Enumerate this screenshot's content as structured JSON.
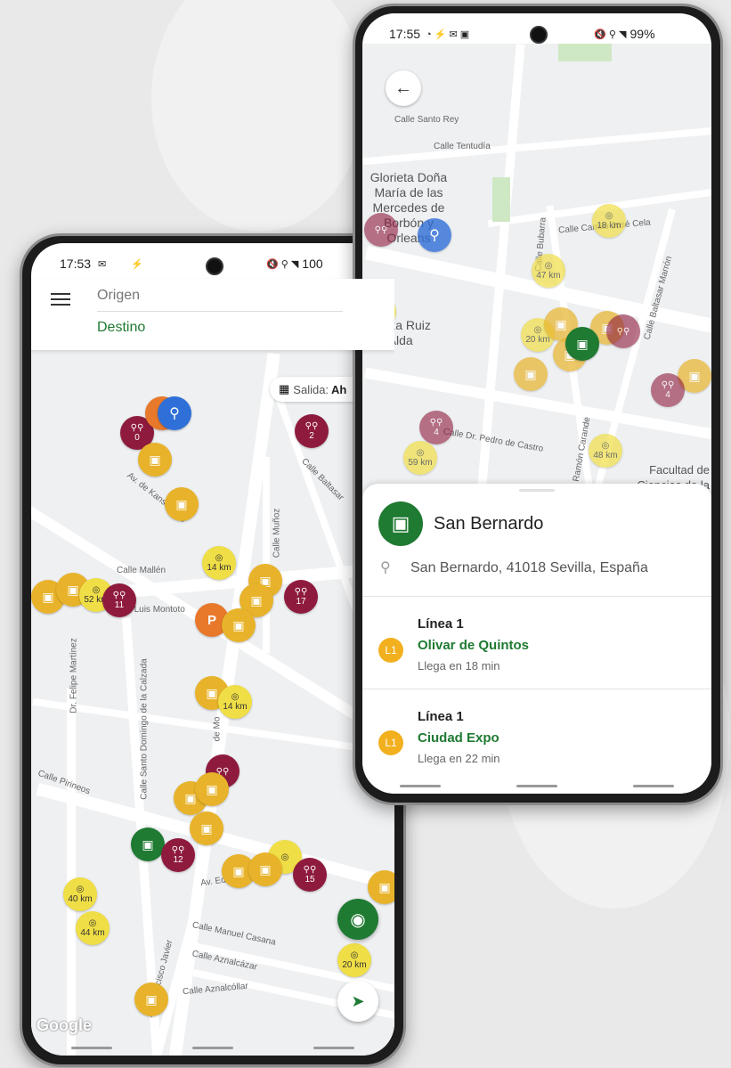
{
  "left_phone": {
    "status": {
      "time": "17:53",
      "battery": "100"
    },
    "search": {
      "origin_placeholder": "Origen",
      "destination_placeholder": "Destino"
    },
    "departure_chip": {
      "label": "Salida:",
      "value": "Ah"
    },
    "streets": [
      "Av. de Kansas City",
      "Calle Mallén",
      "Calle Luis Montoto",
      "Dr. Felipe Martínez",
      "Calle Santo Domingo de la Calzada",
      "Calle Pirineos",
      "Av. Eduardo Dato",
      "Calle Manuel Casana",
      "Calle Aznalcázar",
      "Calle Aznalcóllar",
      "Av. Francisco Javier",
      "Calle Baltasar",
      "Calle Muñoz",
      "de Mo"
    ],
    "markers": {
      "bike_counts": [
        "0",
        "2",
        "11",
        "17",
        "12",
        "15"
      ],
      "distances": [
        "14 km",
        "52 km",
        "14 km",
        "40 km",
        "44 km",
        "20 km"
      ]
    },
    "google_logo": "Google"
  },
  "right_phone": {
    "status": {
      "time": "17:55",
      "battery": "99%"
    },
    "map_labels": [
      "Glorieta Doña María de las Mercedes de Borbón y Orleans",
      "Plaza Ruiz de Alda",
      "Facultad de Ciencias de la Educación",
      "Calle Santo Rey",
      "Calle Tentudía",
      "Calle Bubarra",
      "Calle Camilo José Cela",
      "Calle Dr. Pedro de Castro",
      "Ramón Carande",
      "Calle Baltasar Marrón"
    ],
    "markers": {
      "distances": [
        "18 km",
        "47 km",
        "20 km",
        "59 km",
        "48 km"
      ],
      "bike_counts": [
        "4",
        "4"
      ]
    },
    "stop": {
      "name": "San Bernardo",
      "address": "San Bernardo, 41018 Sevilla, España"
    },
    "lines": [
      {
        "badge": "L1",
        "line": "Línea 1",
        "destination": "Olivar de Quintos",
        "eta": "Llega en 18 min"
      },
      {
        "badge": "L1",
        "line": "Línea 1",
        "destination": "Ciudad Expo",
        "eta": "Llega en 22 min"
      }
    ]
  },
  "colors": {
    "brand_green": "#1f7a32",
    "bus_yellow": "#e8b32a",
    "bike_maroon": "#8e1b3e",
    "line_badge": "#f2b01e"
  }
}
